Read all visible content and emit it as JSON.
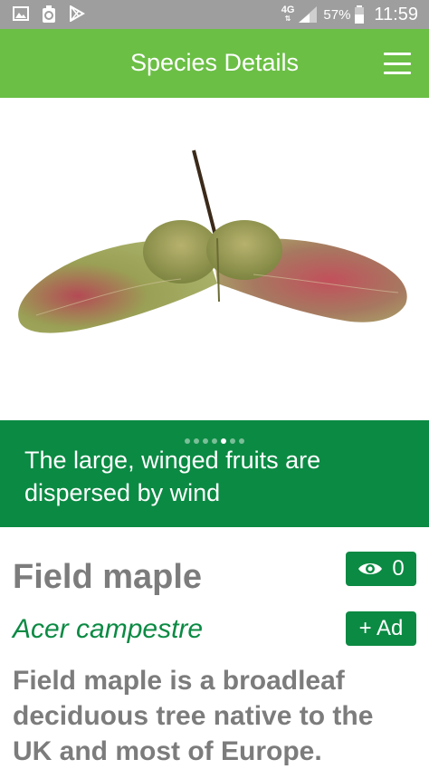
{
  "status_bar": {
    "network": "4G",
    "battery": "57%",
    "time": "11:59",
    "icons": [
      "image-icon",
      "recycle-icon",
      "play-store-icon",
      "signal-icon",
      "battery-icon"
    ]
  },
  "app_bar": {
    "title": "Species Details",
    "menu_icon": "hamburger-menu-icon",
    "color": "#6bbf45"
  },
  "gallery": {
    "image": "winged-seed-photo",
    "dots_total": 7,
    "active_dot": 5,
    "caption": "The large, winged fruits are dispersed by wind",
    "caption_bg": "#0b8a43"
  },
  "species": {
    "common_name": "Field maple",
    "latin_name": "Acer campestre",
    "description": "Field maple is a broadleaf deciduous tree native to the UK and most of Europe."
  },
  "actions": {
    "views_icon": "eye-icon",
    "views_count": "0",
    "add_label": "+ Ad"
  }
}
